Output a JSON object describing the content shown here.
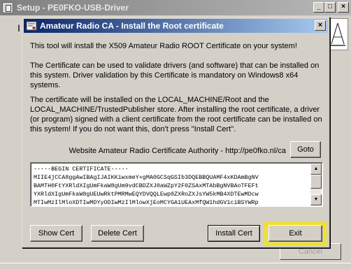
{
  "outer_window": {
    "title": "Setup - PE0FKO-USB-Driver",
    "body_letter": "I",
    "bottom_button_label": "Cancel",
    "controls": {
      "minimize": "_",
      "maximize": "□",
      "close": "×"
    }
  },
  "dialog": {
    "title": "Amateur Radio CA - Install the Root certificate",
    "close_symbol": "×",
    "paragraphs": [
      "This tool will install the X509 Amateur Radio ROOT Certificate on your system!",
      "The Certificate can be used to validate drivers (and software) that can be installed on this system. Driver validation by this Certificate is mandatory on Windows8 x64 systems.",
      "The certificate will be installed on the LOCAL_MACHINE/Root and the LOCAL_MACHINE/TrustedPublisher store. After installing the root certificate, a driver (or program) signed with a client certificate from the root certificate can be installed on this system! If you do not want this, don't press \"Install Cert\"."
    ],
    "authority_label": "Website Amateur Radio Certificate Authority - http://pe0fko.nl/ca",
    "goto_label": "Goto",
    "certificate_text": "-----BEGIN CERTIFICATE-----\nMIIE4jCCA8ggAwIBAgIJAIKKiwxmeY+gMA0GCSqGSIb3DQEBBQUAMF4xKDAmBgNV\nBAMTH0FtYXRldXIgUmFkaW8gUm9vdCBDZXJ0aWZpY2F0ZSAxMTAbBgNVBAoTFEFt\nYXRldXIgUmFkaW8gUEUwRktPMRMwEQYDVQQLEwp0ZXRoZXJsYW5kMB4XDTEwMDcw\nMTIwMzIlMloXDTIwMDYyODIwMzIlMlowXjEoMCYGA1UEAxMfQW1hdGV1ciBSYWRp",
    "buttons": {
      "show_cert": "Show Cert",
      "delete_cert": "Delete Cert",
      "install_cert": "Install Cert",
      "exit": "Exit"
    },
    "scroll_arrows": {
      "up": "▲",
      "down": "▼"
    }
  },
  "colors": {
    "title_active_start": "#0a246a",
    "title_active_end": "#a6caf0",
    "window_face": "#d4d0c8",
    "highlight_box": "#f2e222"
  },
  "icons": {
    "outer_app": "setup-icon",
    "dialog_app": "certificate-icon"
  }
}
